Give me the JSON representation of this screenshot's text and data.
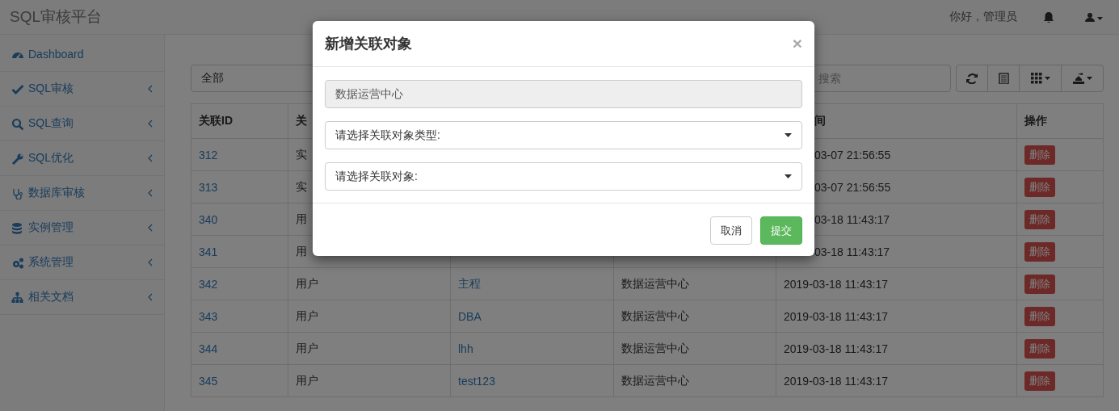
{
  "topbar": {
    "brand": "SQL审核平台",
    "greeting": "你好，管理员"
  },
  "sidebar": {
    "items": [
      {
        "label": "Dashboard",
        "has_submenu": false
      },
      {
        "label": "SQL审核",
        "has_submenu": true
      },
      {
        "label": "SQL查询",
        "has_submenu": true
      },
      {
        "label": "SQL优化",
        "has_submenu": true
      },
      {
        "label": "数据库审核",
        "has_submenu": true
      },
      {
        "label": "实例管理",
        "has_submenu": true
      },
      {
        "label": "系统管理",
        "has_submenu": true
      },
      {
        "label": "相关文档",
        "has_submenu": true
      }
    ]
  },
  "toolbar": {
    "filter": {
      "value": "全部"
    },
    "search": {
      "placeholder": "搜索"
    }
  },
  "table": {
    "columns": [
      {
        "label": "关联ID",
        "cut": false
      },
      {
        "label": "关",
        "cut": false
      },
      null,
      null,
      {
        "label": "间",
        "cut": true
      },
      {
        "label": "操作",
        "cut": false
      }
    ],
    "rows": [
      {
        "cells": [
          "312",
          "实",
          null,
          null,
          "03-07 21:56:55"
        ],
        "time_cut": true,
        "action": "删除"
      },
      {
        "cells": [
          "313",
          "实",
          null,
          null,
          "03-07 21:56:55"
        ],
        "time_cut": true,
        "action": "删除"
      },
      {
        "cells": [
          "340",
          "用",
          null,
          null,
          "03-18 11:43:17"
        ],
        "time_cut": true,
        "action": "删除"
      },
      {
        "cells": [
          "341",
          "用",
          null,
          null,
          "03-18 11:43:17"
        ],
        "time_cut": true,
        "action": "删除"
      },
      {
        "cells": [
          "342",
          "用户",
          "主程",
          "数据运营中心",
          "2019-03-18 11:43:17"
        ],
        "time_cut": false,
        "action": "删除"
      },
      {
        "cells": [
          "343",
          "用户",
          "DBA",
          "数据运营中心",
          "2019-03-18 11:43:17"
        ],
        "time_cut": false,
        "action": "删除"
      },
      {
        "cells": [
          "344",
          "用户",
          "lhh",
          "数据运营中心",
          "2019-03-18 11:43:17"
        ],
        "time_cut": false,
        "action": "删除"
      },
      {
        "cells": [
          "345",
          "用户",
          "test123",
          "数据运营中心",
          "2019-03-18 11:43:17"
        ],
        "time_cut": false,
        "action": "删除"
      }
    ]
  },
  "modal": {
    "title": "新增关联对象",
    "close": "×",
    "fields": [
      {
        "kind": "readonly",
        "value": "数据运营中心"
      },
      {
        "kind": "select",
        "value": "请选择关联对象类型:"
      },
      {
        "kind": "select",
        "value": "请选择关联对象:"
      }
    ],
    "buttons": [
      {
        "label": "取消",
        "kind": "default"
      },
      {
        "label": "提交",
        "kind": "primary"
      }
    ]
  }
}
